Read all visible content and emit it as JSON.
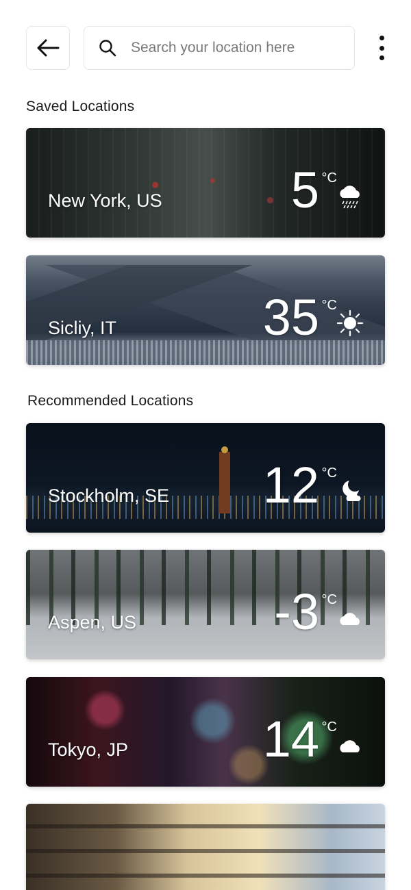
{
  "header": {
    "back_icon": "arrow-left-icon",
    "search_icon": "search-icon",
    "search_placeholder": "Search your location here",
    "search_value": "",
    "more_icon": "more-vertical-icon"
  },
  "saved": {
    "title": "Saved Locations",
    "items": [
      {
        "city": "New York, US",
        "temp": "5",
        "unit": "°C",
        "icon": "rain-cloud-icon"
      },
      {
        "city": "Sicliy, IT",
        "temp": "35",
        "unit": "°C",
        "icon": "sun-icon"
      }
    ]
  },
  "recommended": {
    "title": "Recommended Locations",
    "items": [
      {
        "city": "Stockholm, SE",
        "temp": "12",
        "unit": "°C",
        "icon": "moon-cloud-icon"
      },
      {
        "city": "Aspen, US",
        "temp": "-3",
        "unit": "°C",
        "icon": "cloud-icon"
      },
      {
        "city": "Tokyo, JP",
        "temp": "14",
        "unit": "°C",
        "icon": "cloud-icon"
      }
    ]
  },
  "colors": {
    "background": "#ffffff",
    "border": "#e6e6e6",
    "text": "#1a1a1a",
    "card_text": "#ffffff"
  }
}
